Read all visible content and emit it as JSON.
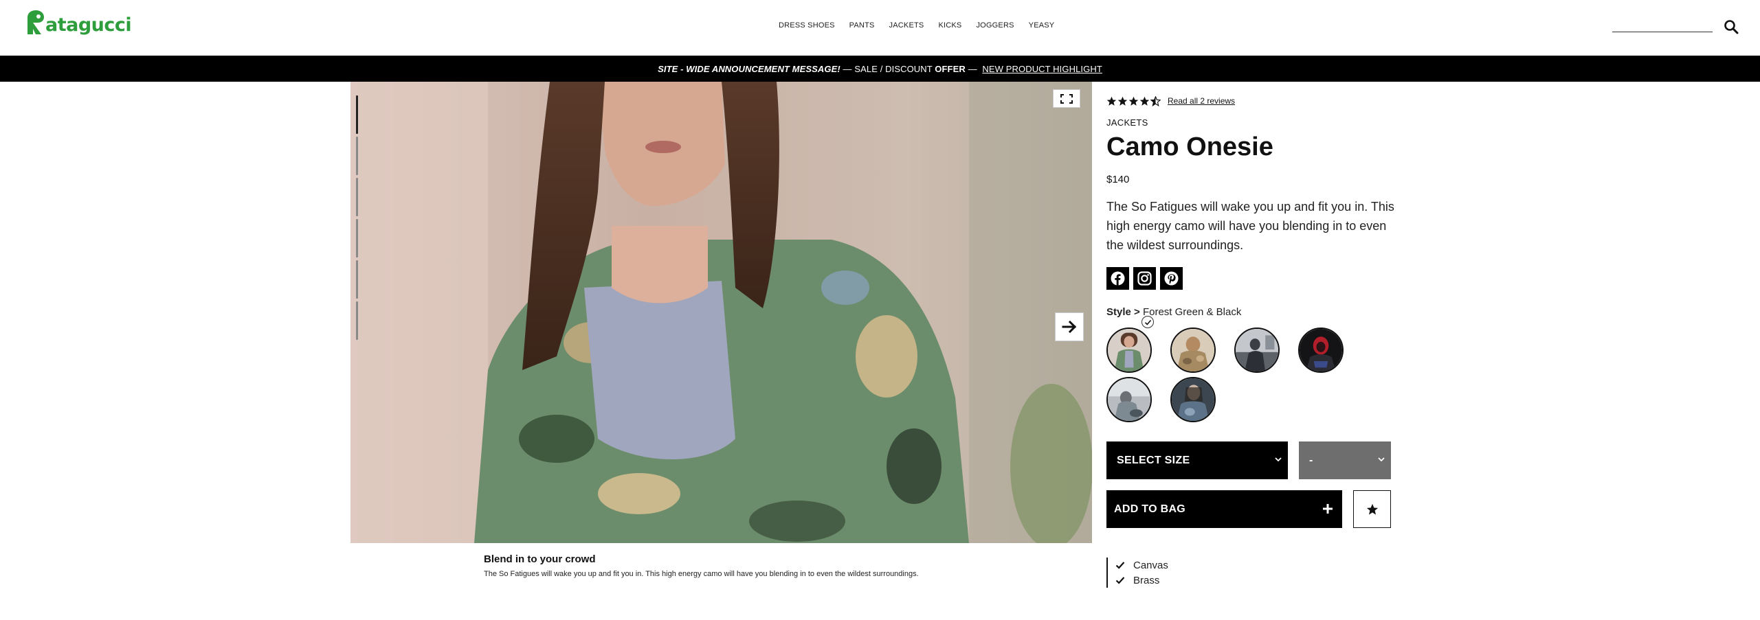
{
  "brand": {
    "logo_text": "atagucci",
    "color": "#2e9e3c"
  },
  "nav": {
    "items": [
      {
        "label": "DRESS SHOES"
      },
      {
        "label": "PANTS"
      },
      {
        "label": "JACKETS"
      },
      {
        "label": "KICKS"
      },
      {
        "label": "JOGGERS"
      },
      {
        "label": "YEASY"
      }
    ]
  },
  "search": {
    "placeholder": "",
    "icon": "search-icon"
  },
  "announcement": {
    "part1": "SITE - WIDE ANNOUNCEMENT MESSAGE!",
    "part2": " — SALE / DISCOUNT ",
    "part3": "OFFER",
    "part4": " — ",
    "link": "NEW PRODUCT HIGHLIGHT"
  },
  "gallery": {
    "image_count": 6,
    "active_index": 0
  },
  "caption": {
    "title": "Blend in to your crowd",
    "body": "The So Fatigues will wake you up and fit you in. This high energy camo will have you blending in to even the wildest surroundings."
  },
  "product": {
    "rating": 4.5,
    "reviews_link": "Read all 2 reviews",
    "category": "JACKETS",
    "title": "Camo Onesie",
    "price": "$140",
    "description": "The So Fatigues will wake you up and fit you in. This high energy camo will have you blending in to even the wildest surroundings.",
    "socials": [
      "facebook-icon",
      "instagram-icon",
      "pinterest-icon"
    ],
    "style_label": "Style >",
    "style_value": "Forest Green & Black",
    "swatch_count": 6,
    "selected_swatch": 0,
    "size_label": "SELECT SIZE",
    "qty_label": "-",
    "add_to_bag": "ADD TO BAG",
    "features": [
      "Canvas",
      "Brass"
    ]
  }
}
